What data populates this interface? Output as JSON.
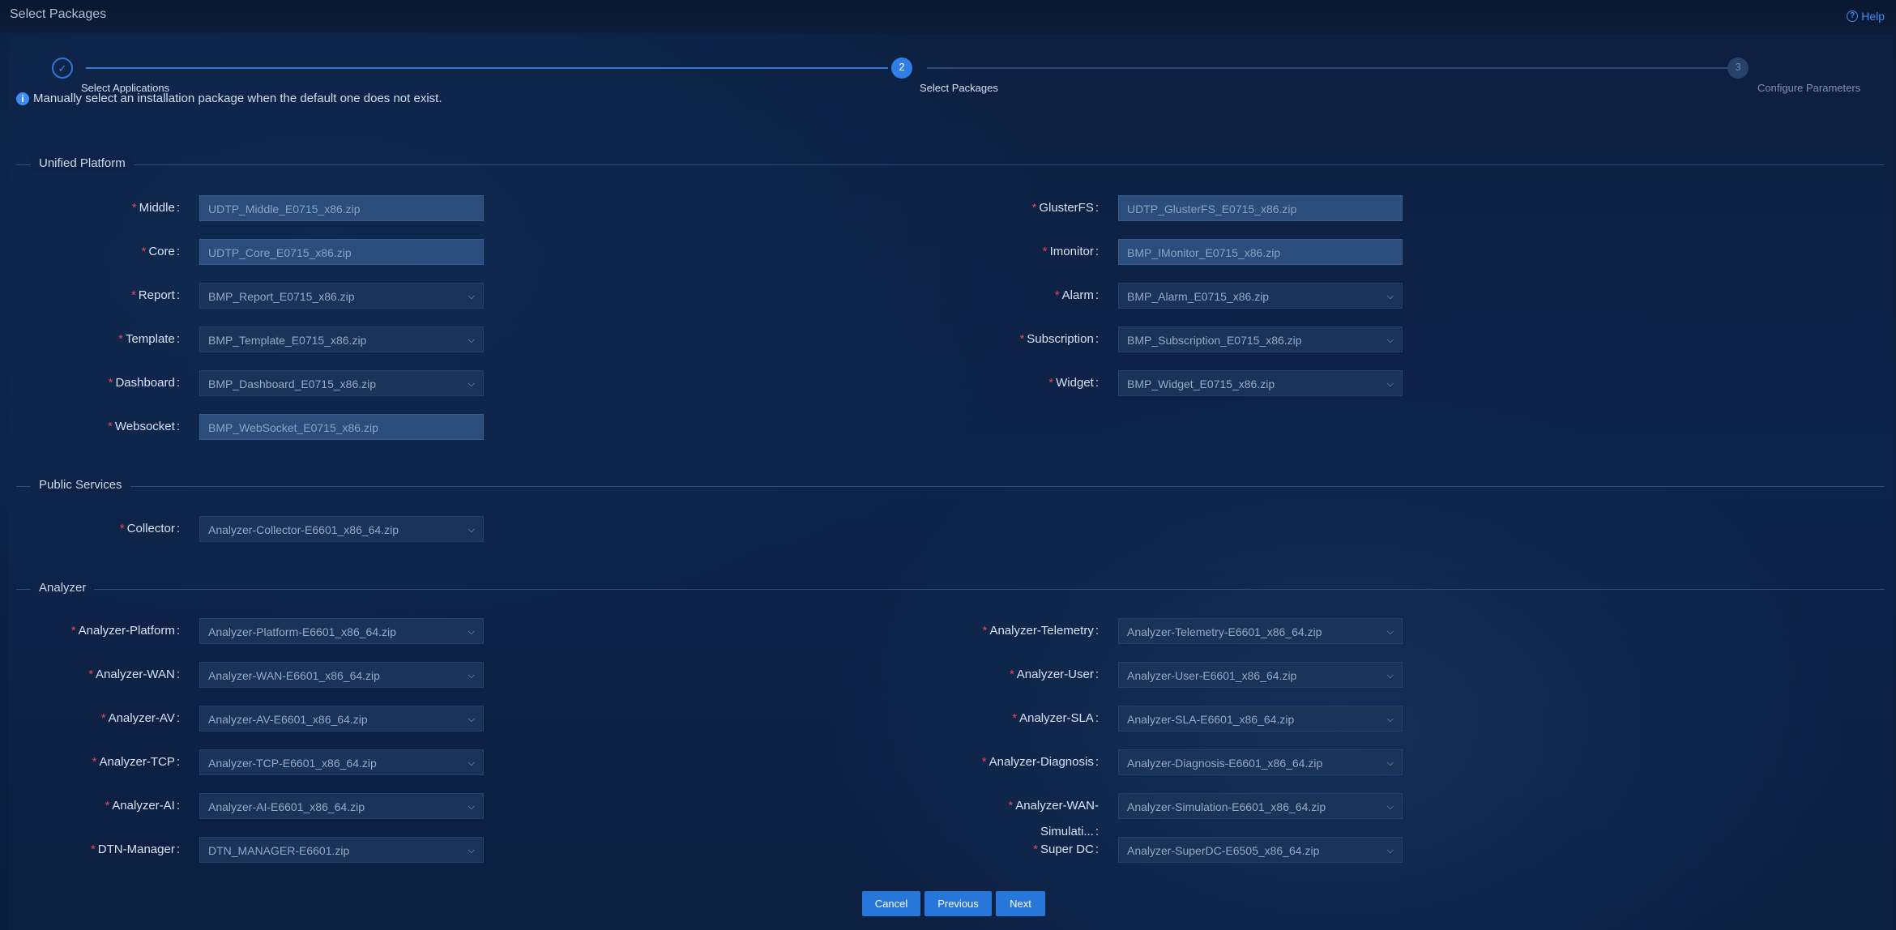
{
  "header": {
    "title": "Select Packages",
    "help_label": "Help"
  },
  "stepper": {
    "steps": [
      {
        "number": "✓",
        "label": "Select Applications",
        "state": "done"
      },
      {
        "number": "2",
        "label": "Select Packages",
        "state": "active"
      },
      {
        "number": "3",
        "label": "Configure Parameters",
        "state": "pending"
      }
    ]
  },
  "info": {
    "icon": "info-icon",
    "text": "Manually select an installation package when the default one does not exist."
  },
  "sections": {
    "unified_platform": "Unified Platform",
    "public_services": "Public Services",
    "analyzer": "Analyzer"
  },
  "fields": {
    "middle": {
      "label": "Middle",
      "value": "UDTP_Middle_E0715_x86.zip"
    },
    "glusterfs": {
      "label": "GlusterFS",
      "value": "UDTP_GlusterFS_E0715_x86.zip"
    },
    "core": {
      "label": "Core",
      "value": "UDTP_Core_E0715_x86.zip"
    },
    "imonitor": {
      "label": "Imonitor",
      "value": "BMP_IMonitor_E0715_x86.zip"
    },
    "report": {
      "label": "Report",
      "value": "BMP_Report_E0715_x86.zip"
    },
    "alarm": {
      "label": "Alarm",
      "value": "BMP_Alarm_E0715_x86.zip"
    },
    "template": {
      "label": "Template",
      "value": "BMP_Template_E0715_x86.zip"
    },
    "subscription": {
      "label": "Subscription",
      "value": "BMP_Subscription_E0715_x86.zip"
    },
    "dashboard": {
      "label": "Dashboard",
      "value": "BMP_Dashboard_E0715_x86.zip"
    },
    "widget": {
      "label": "Widget",
      "value": "BMP_Widget_E0715_x86.zip"
    },
    "websocket": {
      "label": "Websocket",
      "value": "BMP_WebSocket_E0715_x86.zip"
    },
    "collector": {
      "label": "Collector",
      "value": "Analyzer-Collector-E6601_x86_64.zip"
    },
    "analyzer_platform": {
      "label": "Analyzer-Platform",
      "value": "Analyzer-Platform-E6601_x86_64.zip"
    },
    "analyzer_telemetry": {
      "label": "Analyzer-Telemetry",
      "value": "Analyzer-Telemetry-E6601_x86_64.zip"
    },
    "analyzer_wan": {
      "label": "Analyzer-WAN",
      "value": "Analyzer-WAN-E6601_x86_64.zip"
    },
    "analyzer_user": {
      "label": "Analyzer-User",
      "value": "Analyzer-User-E6601_x86_64.zip"
    },
    "analyzer_av": {
      "label": "Analyzer-AV",
      "value": "Analyzer-AV-E6601_x86_64.zip"
    },
    "analyzer_sla": {
      "label": "Analyzer-SLA",
      "value": "Analyzer-SLA-E6601_x86_64.zip"
    },
    "analyzer_tcp": {
      "label": "Analyzer-TCP",
      "value": "Analyzer-TCP-E6601_x86_64.zip"
    },
    "analyzer_diagnosis": {
      "label": "Analyzer-Diagnosis",
      "value": "Analyzer-Diagnosis-E6601_x86_64.zip"
    },
    "analyzer_ai": {
      "label": "Analyzer-AI",
      "value": "Analyzer-AI-E6601_x86_64.zip"
    },
    "analyzer_wan_sim": {
      "label": "Analyzer-WAN-Simulati...",
      "value": "Analyzer-Simulation-E6601_x86_64.zip"
    },
    "dtn_manager": {
      "label": "DTN-Manager",
      "value": "DTN_MANAGER-E6601.zip"
    },
    "super_dc": {
      "label": "Super DC",
      "value": "Analyzer-SuperDC-E6505_x86_64.zip"
    }
  },
  "buttons": {
    "cancel": "Cancel",
    "previous": "Previous",
    "next": "Next"
  },
  "colors": {
    "accent": "#2f7ee3",
    "required": "#e8455a"
  }
}
